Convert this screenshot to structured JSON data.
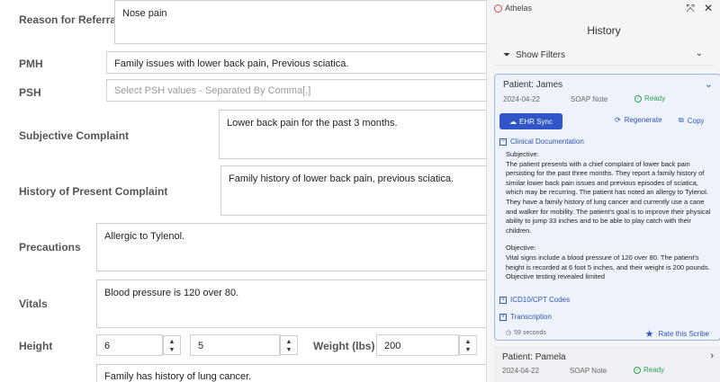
{
  "form": {
    "referral": {
      "label": "Reason for Referral",
      "value": "Nose pain"
    },
    "pmh": {
      "label": "PMH",
      "value": "Family issues with lower back pain, Previous sciatica."
    },
    "psh": {
      "label": "PSH",
      "placeholder": "Select PSH values - Separated By Comma[,]"
    },
    "subjective": {
      "label": "Subjective Complaint",
      "value": "Lower back pain for the past 3 months."
    },
    "hpc": {
      "label": "History of Present Complaint",
      "value": "Family history of lower back pain, previous sciatica."
    },
    "precautions": {
      "label": "Precautions",
      "value": "Allergic to Tylenol."
    },
    "vitals": {
      "label": "Vitals",
      "value": "Blood pressure is 120 over 80."
    },
    "height": {
      "label": "Height",
      "feet": "6",
      "inches": "5"
    },
    "weight": {
      "label": "Weight (lbs)",
      "value": "200"
    },
    "family": {
      "value": "Family has history of lung cancer."
    }
  },
  "panel": {
    "brand": "Athelas",
    "title": "History",
    "filters": "Show Filters",
    "card1": {
      "patient": "Patient: James",
      "date": "2024-04-22",
      "type": "SOAP Note",
      "status": "Ready",
      "ehr": "EHR Sync",
      "regenerate": "Regenerate",
      "copy": "Copy",
      "clinical": "Clinical Documentation",
      "subjective_h": "Subjective:",
      "subjective_t": "The patient presents with a chief complaint of lower back pain persisting for the past three months. They report a family history of similar lower back pain issues and previous episodes of sciatica, which may be recurring. The patient has noted an allergy to Tylenol. They have a family history of lung cancer and currently use a cane and walker for mobility. The patient's goal is to improve their physical ability to jump 33 inches and to be able to play catch with their children.",
      "objective_h": "Objective:",
      "objective_t": "Vital signs include a blood pressure of 120 over 80. The patient's height is recorded at 6 foot 5 inches, and their weight is 200 pounds. Objective testing revealed limited",
      "icd": "ICD10/CPT Codes",
      "transcription": "Transcription",
      "duration": "59 seconds",
      "rate": "Rate this Scribe"
    },
    "card2": {
      "patient": "Patient: Pamela",
      "date": "2024-04-22",
      "type": "SOAP Note",
      "status": "Ready"
    }
  },
  "colors": {
    "accent": "#2f55c8",
    "ready": "#2e9e57",
    "brand": "#e0453d"
  }
}
